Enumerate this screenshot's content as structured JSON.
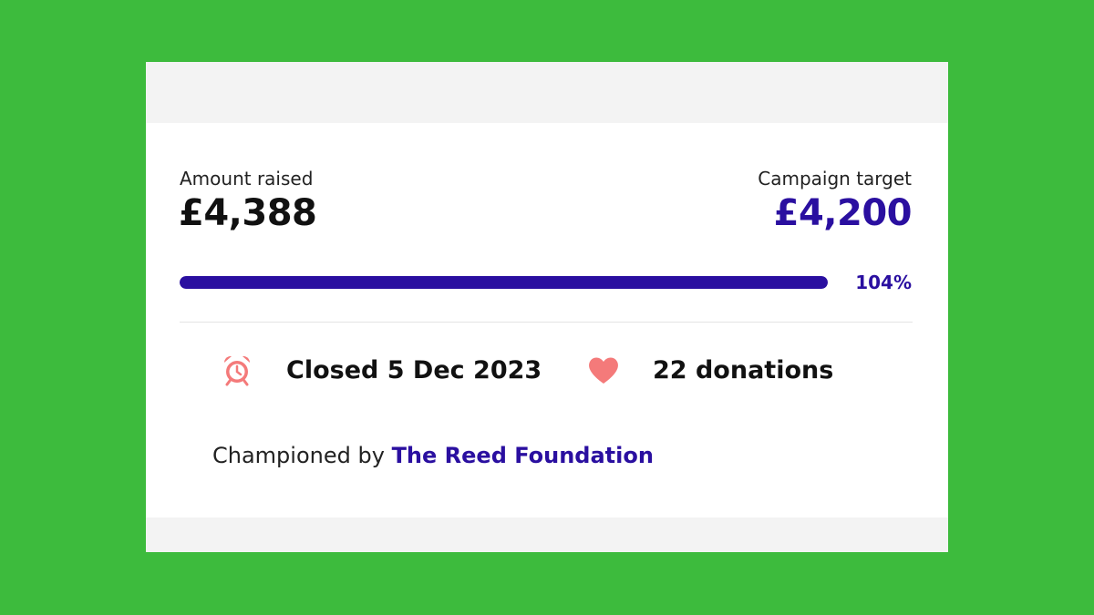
{
  "raised": {
    "label": "Amount raised",
    "amount": "£4,388"
  },
  "target": {
    "label": "Campaign target",
    "amount": "£4,200"
  },
  "progress": {
    "percent_text": "104%",
    "fill_fraction": 1.0
  },
  "stats": {
    "closed": {
      "icon": "alarm-clock-icon",
      "text": "Closed 5 Dec 2023"
    },
    "donations": {
      "icon": "heart-icon",
      "text": "22 donations"
    }
  },
  "champion": {
    "prefix": "Championed by",
    "name": "The Reed Foundation"
  },
  "colors": {
    "background": "#3dbb3d",
    "accent": "#2a0fa0",
    "icon": "#f47a7a"
  }
}
